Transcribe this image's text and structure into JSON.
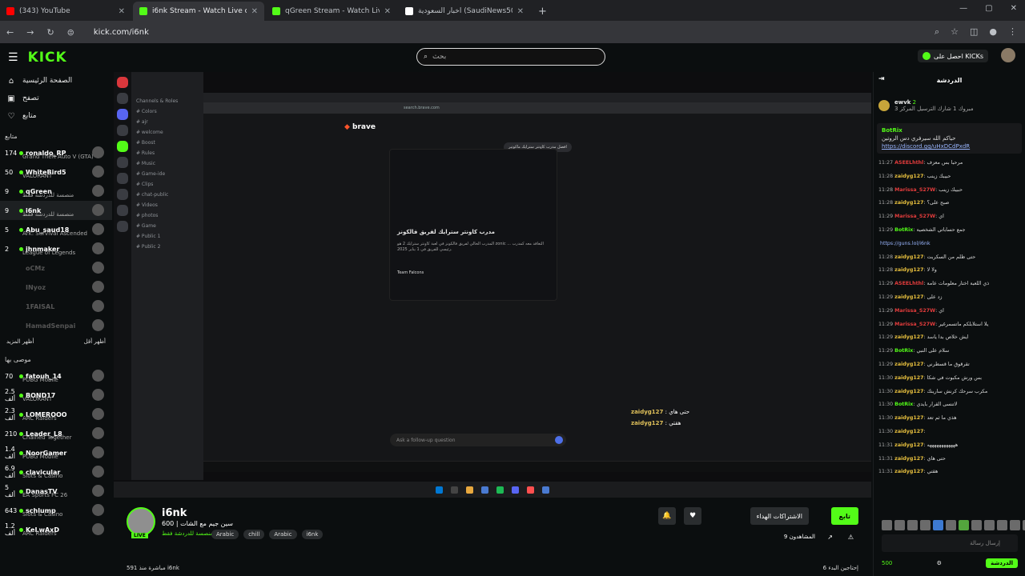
{
  "browser": {
    "tabs": [
      {
        "title": "(343) YouTube",
        "color": "#ff0000"
      },
      {
        "title": "i6nk Stream - Watch Live o",
        "color": "#53fc18"
      },
      {
        "title": "qGreen Stream - Watch Live o",
        "color": "#53fc18"
      },
      {
        "title": "أخبار السعودية (SaudiNews50@)",
        "color": "#ffffff"
      }
    ],
    "url": "kick.com/i6nk"
  },
  "topnav": {
    "logo": "KICK",
    "search_placeholder": "بحث",
    "get_kicks": "احصل على KICKs"
  },
  "leftnav": {
    "main": [
      "الصفحة الرئيسية",
      "تصفح",
      "متابع"
    ],
    "following_label": "متابع",
    "channels": [
      {
        "count": "174",
        "name": "ronaldo_RP",
        "sub": "Grand Theft Auto V (GTA)"
      },
      {
        "count": "50",
        "name": "WhiteBird5",
        "sub": "VALORANT"
      },
      {
        "count": "9",
        "name": "qGreen",
        "sub": "منصسة للدردشة فقط"
      },
      {
        "count": "9",
        "name": "i6nk",
        "sub": "منصسة للدردشة فقط"
      },
      {
        "count": "5",
        "name": "Abu_saud18",
        "sub": "Ark: Survival Ascended"
      },
      {
        "count": "2",
        "name": "jhnmaker",
        "sub": "League of Legends"
      },
      {
        "count": "",
        "name": "oCMz",
        "sub": ""
      },
      {
        "count": "",
        "name": "INyoz",
        "sub": ""
      },
      {
        "count": "",
        "name": "1FAISAL",
        "sub": ""
      },
      {
        "count": "",
        "name": "HamadSenpai",
        "sub": ""
      }
    ],
    "show_more": "أظهر المزيد",
    "show_less": "أظهر أقل",
    "recommended_label": "موصى بها",
    "recommended": [
      {
        "count": "70",
        "name": "fatouh_14",
        "sub": "PUBG Mobile"
      },
      {
        "count": "2.5 ألف",
        "name": "BOND17",
        "sub": "VALORANT"
      },
      {
        "count": "2.3 ألف",
        "name": "LOMEROOO",
        "sub": "ARC Raiders"
      },
      {
        "count": "210",
        "name": "Leader_L8",
        "sub": "Chained Together"
      },
      {
        "count": "1.4 ألف",
        "name": "NoorGamer",
        "sub": "PUBG Mobile"
      },
      {
        "count": "6.9 ألف",
        "name": "clavicular",
        "sub": "Slots & Casino"
      },
      {
        "count": "5 ألف",
        "name": "DanasTV",
        "sub": "EA Sports FC 26"
      },
      {
        "count": "643",
        "name": "schlump",
        "sub": "Slots & Casino"
      },
      {
        "count": "1.2 ألف",
        "name": "KeLwAxD",
        "sub": "ARC Raiders"
      }
    ]
  },
  "player": {
    "search_question": "افضل مدرب كاونتر سترايك ماكوتير",
    "answer_heading": "مدرب كاونتر سترايك لفريق فالكونز",
    "answer_text": "المدرب الحالي لفريق فالكونز في لعبة كاونتر سترايك 2 هو zonic ... التعاقد معه كمدرب رئيسي للفريق في 1 يناير 2025.",
    "team": "Team Falcons",
    "followup": "Ask a follow-up question",
    "overlay_chat": [
      {
        "user": "zaidyg127",
        "text": "حتى هاي"
      },
      {
        "user": "zaidyg127",
        "text": "هقتي"
      }
    ]
  },
  "stream": {
    "name": "i6nk",
    "title": "سين جيم مع الشات | 600",
    "category": "منصسة للدردشة فقط",
    "tags": [
      "Arabic",
      "chill",
      "Arabic",
      "i6nk"
    ],
    "follow": "تابع",
    "subscriptions": "الاشتراكات الهداء",
    "viewers": "9 المشاهدون",
    "left_bottom": "مباشرة منذ 591 i6nk",
    "right_bottom": "إحتاجين البدء 6"
  },
  "chat": {
    "title": "الدردشة",
    "pinned": {
      "user": "ewvk",
      "count": "2",
      "text": "مبروك 1 شارك الترسيل المركز 3"
    },
    "bot": {
      "user": "BotRix",
      "text": "حياكم الله سيرفري دس الروتين",
      "link": "https://discord.gg/uHxDCdPxdR"
    },
    "messages": [
      {
        "t": "11:27",
        "u": "ASEELhthl",
        "c": "#e23c3c",
        "m": "مرحبا بس معزف"
      },
      {
        "t": "11:28",
        "u": "zaidyg127",
        "c": "#e8c03e",
        "m": "حبيبك زينب"
      },
      {
        "t": "11:28",
        "u": "Marissa_S27W",
        "c": "#e23c3c",
        "m": "حبيبك زينب"
      },
      {
        "t": "11:28",
        "u": "zaidyg127",
        "c": "#e8c03e",
        "m": "صبح على؟"
      },
      {
        "t": "11:29",
        "u": "Marissa_S27W",
        "c": "#e23c3c",
        "m": "اي"
      },
      {
        "t": "11:29",
        "u": "BotRix",
        "c": "#53fc18",
        "m": "جمع حساباتي الشخصية"
      },
      {
        "t": "",
        "u": "",
        "c": "#9ab6ff",
        "m": "https://guns.lol/i6nk"
      },
      {
        "t": "11:28",
        "u": "zaidyg127",
        "c": "#e8c03e",
        "m": "حتى ظلم من السكربت"
      },
      {
        "t": "11:28",
        "u": "zaidyg127",
        "c": "#e8c03e",
        "m": "ولا لا"
      },
      {
        "t": "11:29",
        "u": "ASEELhthl",
        "c": "#e23c3c",
        "m": "ذي اللعبة اختار معلومات عامة"
      },
      {
        "t": "11:29",
        "u": "zaidyg127",
        "c": "#e8c03e",
        "m": "زد على"
      },
      {
        "t": "11:29",
        "u": "Marissa_S27W",
        "c": "#e23c3c",
        "m": "اي"
      },
      {
        "t": "11:29",
        "u": "Marissa_S27W",
        "c": "#e23c3c",
        "m": "يلا استلابلكم ماتسمرغير"
      },
      {
        "t": "11:29",
        "u": "zaidyg127",
        "c": "#e8c03e",
        "m": "ايش خلاص بدا ياسد"
      },
      {
        "t": "11:29",
        "u": "BotRix",
        "c": "#53fc18",
        "m": "سلام على النبي"
      },
      {
        "t": "11:29",
        "u": "zaidyg127",
        "c": "#e8c03e",
        "m": "تقرقوق ما قسطرني"
      },
      {
        "t": "11:30",
        "u": "zaidyg127",
        "c": "#e8c03e",
        "m": "بس ورش مكبوت في شكا"
      },
      {
        "t": "11:30",
        "u": "zaidyg127",
        "c": "#e8c03e",
        "m": "مكرب سرحك كرنش سارينك"
      },
      {
        "t": "11:30",
        "u": "BotRix",
        "c": "#53fc18",
        "m": "لاتنسى القرار بايدي"
      },
      {
        "t": "11:30",
        "u": "zaidyg127",
        "c": "#e8c03e",
        "m": "هذي ما ثم تعد"
      },
      {
        "t": "11:30",
        "u": "zaidyg127",
        "c": "#e8c03e",
        "m": ""
      },
      {
        "t": "11:31",
        "u": "zaidyg127",
        "c": "#e8c03e",
        "m": "ههههههههههههه"
      },
      {
        "t": "11:31",
        "u": "zaidyg127",
        "c": "#e8c03e",
        "m": "حتى هاي"
      },
      {
        "t": "11:31",
        "u": "zaidyg127",
        "c": "#e8c03e",
        "m": "هقتي"
      }
    ],
    "input_placeholder": "إرسال رسالة",
    "kicks": "500",
    "send": "الدردشة"
  }
}
